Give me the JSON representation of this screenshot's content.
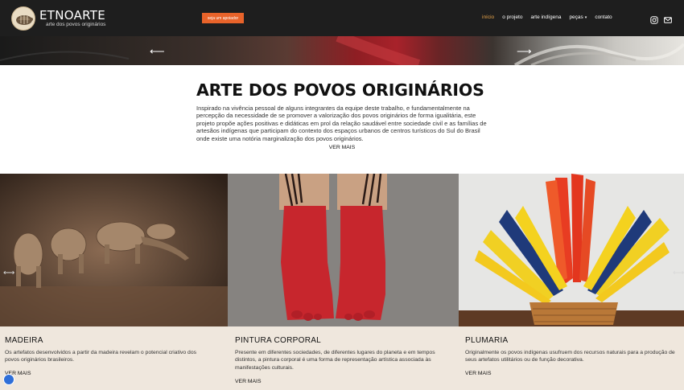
{
  "header": {
    "logo": {
      "name": "ETNOARTE",
      "tagline": "arte dos povos originários"
    },
    "cta_label": "seja um apoiador",
    "nav": [
      {
        "label": "início",
        "active": true
      },
      {
        "label": "o projeto",
        "active": false
      },
      {
        "label": "arte indígena",
        "active": false
      },
      {
        "label": "peças",
        "active": false,
        "caret": "▾"
      },
      {
        "label": "contato",
        "active": false
      }
    ],
    "social": [
      "instagram-icon",
      "mail-icon"
    ]
  },
  "hero": {
    "prev_arrow": "⟵",
    "next_arrow": "⟶"
  },
  "intro": {
    "title": "ARTE DOS POVOS ORIGINÁRIOS",
    "body": "Inspirado na vivência pessoal de alguns integrantes da equipe deste trabalho, e fundamentalmente na percepção da necessidade de se promover a valorização dos povos originários de forma igualitária, este projeto propõe ações positivas e didáticas em prol da relação saudável entre sociedade civil e as famílias de artesãos indígenas que participam do contexto dos espaços urbanos de centros turísticos do Sul do Brasil onde existe uma notória marginalização dos povos originários.",
    "more": "VER MAIS"
  },
  "cards": [
    {
      "title": "MADEIRA",
      "description": "Os artefatos desenvolvidos a partir da madeira revelam o potencial criativo dos povos originários brasileiros.",
      "more": "VER MAIS"
    },
    {
      "title": "PINTURA CORPORAL",
      "description": "Presente em diferentes sociedades, de diferentes lugares do planeta e em tempos distintos, a pintura corporal é uma forma de representação artística associada às manifestações culturais.",
      "more": "VER MAIS"
    },
    {
      "title": "PLUMARIA",
      "description": "Originalmente os povos indígenas usufruem dos recursos naturais para a produção de seus artefatos utilitários ou de função decorativa.",
      "more": "VER MAIS"
    }
  ],
  "colors": {
    "header_bg": "#1e1e1e",
    "accent": "#e8632a",
    "nav_active": "#e8a44a",
    "panel_bg": "#efe7dd"
  }
}
